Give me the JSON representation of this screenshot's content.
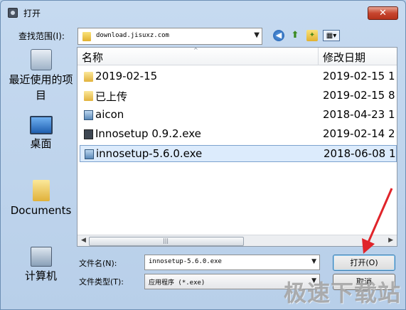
{
  "window": {
    "title": "打开",
    "close_glyph": "✕"
  },
  "lookin": {
    "label": "查找范围(I):",
    "value": "download.jisuxz.com",
    "arrow": "▼"
  },
  "toolbar": {
    "back_glyph": "◀",
    "up_glyph": "⬆",
    "new_folder_glyph": "✦",
    "view_glyph": "▦▾"
  },
  "places": [
    {
      "label": "最近使用的项目",
      "icon": "recent-places-icon"
    },
    {
      "label": "桌面",
      "icon": "desktop-icon"
    },
    {
      "label": "Documents",
      "icon": "documents-folder-icon"
    },
    {
      "label": "计算机",
      "icon": "computer-icon"
    }
  ],
  "columns": {
    "name": "名称",
    "date": "修改日期",
    "sort_caret": "^"
  },
  "files": [
    {
      "name": "2019-02-15",
      "date": "2019-02-15 1",
      "type": "folder"
    },
    {
      "name": "已上传",
      "date": "2019-02-15 8",
      "type": "folder"
    },
    {
      "name": "aicon",
      "date": "2018-04-23 1",
      "type": "setup"
    },
    {
      "name": "Innosetup 0.9.2.exe",
      "date": "2019-02-14 2",
      "type": "exe"
    },
    {
      "name": "innosetup-5.6.0.exe",
      "date": "2018-06-08 1",
      "type": "setup",
      "selected": true
    }
  ],
  "scrollbar": {
    "left": "◀",
    "right": "▶",
    "grip": "|||"
  },
  "filename": {
    "label": "文件名(N):",
    "value": "innosetup-5.6.0.exe",
    "arrow": "▼"
  },
  "filetype": {
    "label": "文件类型(T):",
    "value": "应用程序 (*.exe)",
    "arrow": "▼"
  },
  "buttons": {
    "open": "打开(O)",
    "cancel": "取消"
  },
  "watermark": "极速下载站",
  "colors": {
    "accent_arrow": "#e0242a",
    "selection": "#dcebfc"
  }
}
